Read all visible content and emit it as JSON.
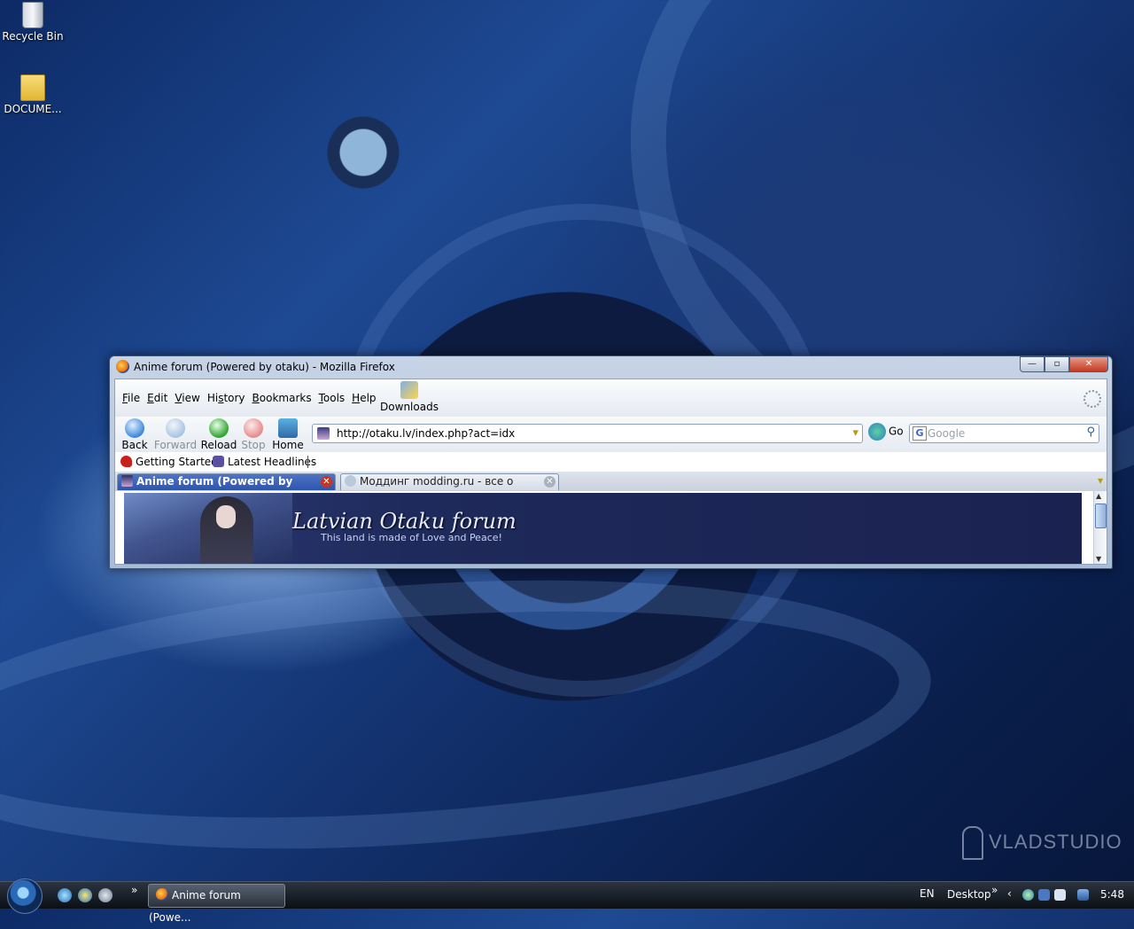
{
  "desktop": {
    "icons": [
      {
        "label": "Recycle Bin",
        "icon": "recycle-bin-icon"
      },
      {
        "label": "DOCUME...",
        "icon": "folder-icon"
      }
    ],
    "watermark": "VLADSTUDIO"
  },
  "window": {
    "title": "Anime forum (Powered by otaku) - Mozilla Firefox",
    "controls": {
      "minimize": "—",
      "maximize": "▫",
      "close": "✕"
    }
  },
  "menubar": {
    "items": [
      {
        "accel": "F",
        "rest": "ile"
      },
      {
        "accel": "E",
        "rest": "dit"
      },
      {
        "accel": "V",
        "rest": "iew"
      },
      {
        "accel": "",
        "pre": "Hi",
        "accel2": "s",
        "rest": "tory"
      },
      {
        "accel": "B",
        "rest": "ookmarks"
      },
      {
        "accel": "T",
        "rest": "ools"
      },
      {
        "accel": "H",
        "rest": "elp"
      }
    ],
    "downloads_label": "Downloads"
  },
  "navbar": {
    "back": "Back",
    "forward": "Forward",
    "reload": "Reload",
    "stop": "Stop",
    "home": "Home",
    "url": "http://otaku.lv/index.php?act=idx",
    "go": "Go",
    "search_placeholder": "Google"
  },
  "bookmarks": [
    {
      "label": "Getting Started",
      "icon": "getting-started-icon"
    },
    {
      "label": "Latest Headlines",
      "icon": "rss-icon"
    }
  ],
  "tabs": [
    {
      "label": "Anime forum (Powered by otaku)",
      "active": true
    },
    {
      "label": "Моддинг modding.ru - все о модди...",
      "active": false
    }
  ],
  "page": {
    "banner_title": "Latvian Otaku forum",
    "banner_subtitle": "This land is made   of Love and Peace!"
  },
  "taskbar": {
    "task_label": "Anime forum (Powe...",
    "chevron": "»",
    "language": "EN",
    "desktop_label": "Desktop",
    "clock": "5:48"
  },
  "colors": {
    "active_tab": "#2e55ad",
    "banner_bg": "#1e2a5b"
  }
}
